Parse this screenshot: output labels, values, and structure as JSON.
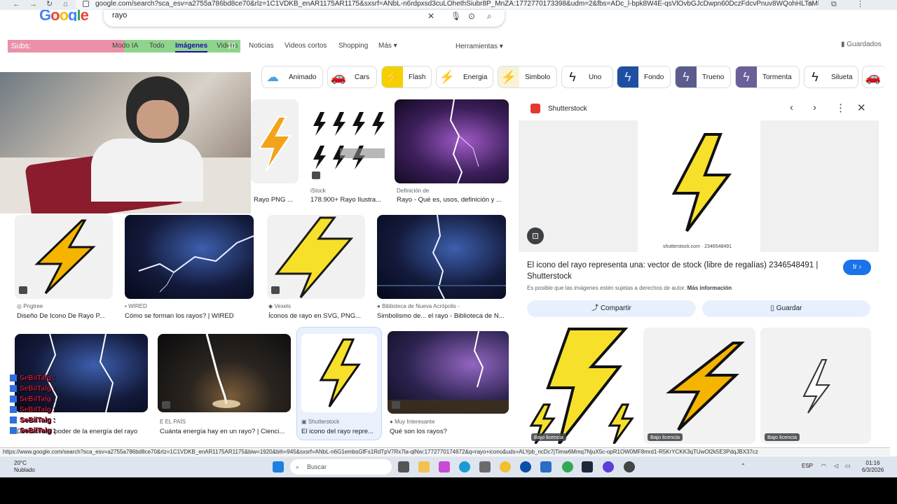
{
  "browser": {
    "url": "google.com/search?sca_esv=a2755a786bd8ce70&rlz=1C1VDKB_enAR1175AR1175&sxsrf=ANbL-n6rdpxsd3cuLOhethSiubr8P_MnZA:1772770173398&udm=2&fbs=ADc_l-bpk8W4E-qsVlOvbGJcDwpn60DczFdcvPnuv8WQohHLTaMb_WtLz8oZ04..."
  },
  "google": {
    "logo": "Google",
    "query": "rayo"
  },
  "tabs": [
    "Modo IA",
    "Todo",
    "Imágenes",
    "Videos",
    "Noticias",
    "Videos cortos",
    "Shopping",
    "Más"
  ],
  "tools_label": "Herramientas",
  "saved_label": "Guardados",
  "overlay": {
    "subs_label": "Subs:",
    "subs_count": "10"
  },
  "chips": [
    {
      "label": "Animado",
      "icon": "cloud-icon",
      "color": "#4aa3df"
    },
    {
      "label": "Cars",
      "icon": "car-icon",
      "color": "#d0312d"
    },
    {
      "label": "Flash",
      "icon": "bolt-icon",
      "color": "#f5d000"
    },
    {
      "label": "Energia",
      "icon": "bolt-icon",
      "color": "#f2a31b"
    },
    {
      "label": "Simbolo",
      "icon": "bolt-icon",
      "color": "#d9c64a"
    },
    {
      "label": "Uno",
      "icon": "bolt-icon",
      "color": "#222222"
    },
    {
      "label": "Fondo",
      "icon": "storm-icon",
      "color": "#1f4fa0"
    },
    {
      "label": "Trueno",
      "icon": "storm-icon",
      "color": "#5b5c8c"
    },
    {
      "label": "Tormenta",
      "icon": "storm-icon",
      "color": "#6a5f96"
    },
    {
      "label": "Silueta",
      "icon": "bolt-icon",
      "color": "#222222"
    }
  ],
  "results": [
    {
      "source": "",
      "title": "Rayo PNG ..."
    },
    {
      "source": "iStock",
      "title": "178.900+ Rayo Ilustra..."
    },
    {
      "source": "Definición de",
      "title": "Rayo - Qué es, usos, definición y ..."
    },
    {
      "source": "Pngtree",
      "title": "Diseño De Icono De Rayo P..."
    },
    {
      "source": "WIRED",
      "title": "Cómo se forman los rayos? | WIRED"
    },
    {
      "source": "Vexels",
      "title": "Íconos de rayo en SVG, PNG..."
    },
    {
      "source": "Biblioteca de Nueva Acrópolis -",
      "title": "Simbolismo de... el rayo - Biblioteca de N..."
    },
    {
      "source": "",
      "title": "Descubre el poder de la energía del rayo"
    },
    {
      "source": "EL PAÍS",
      "title": "Cuánta energía hay en un rayo? | Cienci..."
    },
    {
      "source": "Shutterstock",
      "title": "El icono del rayo repre..."
    },
    {
      "source": "Muy Interesante",
      "title": "Qué son los rayos?"
    }
  ],
  "panel": {
    "source": "Shutterstock",
    "image_caption": "shutterstock.com · 2346548491",
    "title": "El icono del rayo representa una: vector de stock (libre de regalías) 2346548491 | Shutterstock",
    "go_label": "Ir",
    "rights_text": "Es posible que las imágenes estén sujetas a derechos de autor.",
    "more_info": "Más información",
    "share_label": "Compartir",
    "save_label": "Guardar",
    "license_label": "Bajo licencia"
  },
  "chat": [
    "SeBilTalg :",
    "SeBilTalg :",
    "SeBilTalg :",
    "SeBilTalg :",
    "SeBilTalg :",
    "SeBilTalg :"
  ],
  "status_url": "https://www.google.com/search?sca_esv=a2755a786bd8ce70&rlz=1C1VDKB_enAR1175AR1175&biw=1920&bih=945&sxsrf=ANbL-n6G1embsGfFs1RdTpV7Rx7la-qlNw:1772770174672&q=rayo+icono&uds=ALYpb_ncDc7jTimw6Mmq7NjuX5c-opR1OW0MF8mrd1-R5KrYCKK3qTUwOl2k5E3PdqJBX37cz",
  "taskbar": {
    "temp": "20°C",
    "weather": "Nublado",
    "search": "Buscar",
    "lang": "ESP",
    "time": "01:16",
    "date": "6/3/2026"
  }
}
